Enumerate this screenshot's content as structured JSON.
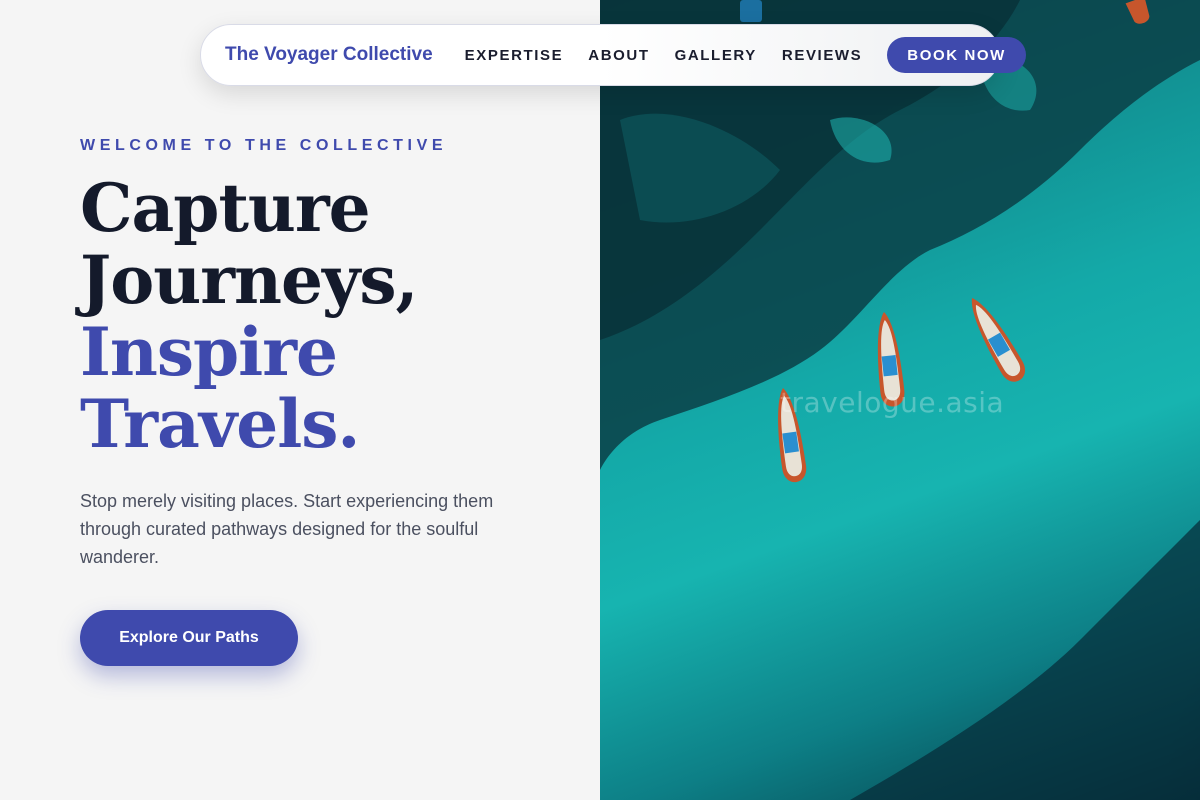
{
  "nav": {
    "brand": "The Voyager Collective",
    "links": [
      "EXPERTISE",
      "ABOUT",
      "GALLERY",
      "REVIEWS"
    ],
    "cta": "BOOK NOW"
  },
  "hero": {
    "eyebrow": "WELCOME TO THE COLLECTIVE",
    "headline": [
      "Capture",
      "Journeys,"
    ],
    "headline_accent": [
      "Inspire",
      "Travels."
    ],
    "lead": "Stop merely visiting places. Start experiencing them through curated pathways designed for the soulful wanderer.",
    "cta": "Explore Our Paths"
  },
  "image": {
    "watermark": "travelogue.asia",
    "subject": "aerial-view-boats-turquoise-sea"
  },
  "colors": {
    "accent": "#3f4aad",
    "heading": "#141a2b",
    "background": "#f5f5f5",
    "sea": "#17b4b0"
  }
}
